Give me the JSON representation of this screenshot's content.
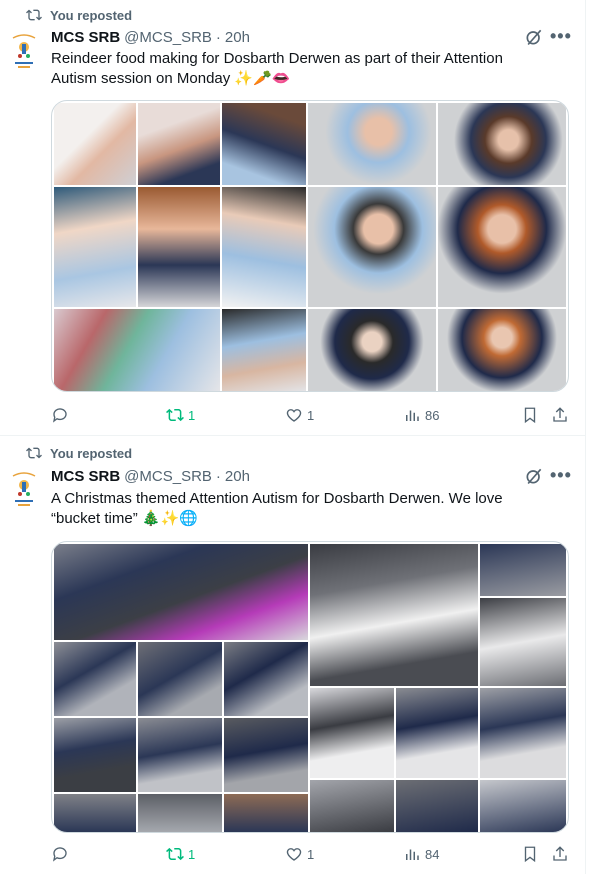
{
  "tweets": [
    {
      "repost_label": "You reposted",
      "author_name": "MCS SRB",
      "author_handle": "@MCS_SRB",
      "separator": "·",
      "time": "20h",
      "text_line1": "Reindeer food making for Dosbarth Derwen as part of their Attention",
      "text_line2": "Autism session on Monday ✨🥕👄",
      "replies": "",
      "reposts": "1",
      "likes": "1",
      "views": "86"
    },
    {
      "repost_label": "You reposted",
      "author_name": "MCS SRB",
      "author_handle": "@MCS_SRB",
      "separator": "·",
      "time": "20h",
      "text_line1": "A Christmas themed Attention Autism for Dosbarth Derwen. We love",
      "text_line2": "“bucket time” 🎄✨🌐",
      "replies": "",
      "reposts": "1",
      "likes": "1",
      "views": "84"
    }
  ],
  "icons": {
    "repost": "repost-icon",
    "grok": "grok-icon",
    "more": "more-icon",
    "reply": "reply-icon",
    "like": "heart-icon",
    "views": "views-icon",
    "bookmark": "bookmark-icon",
    "share": "share-icon"
  },
  "colors": {
    "repost_active": "#00ba7c",
    "secondary_text": "#536471",
    "border": "#eff3f4",
    "grey_photo_bg": "#cdcfd1",
    "navy_uniform": "#1f2a4a",
    "light_blue_uniform": "#9dbfe0"
  }
}
